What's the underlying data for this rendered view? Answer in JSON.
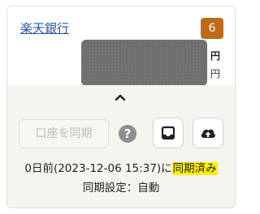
{
  "account": {
    "bank_name": "楽天銀行",
    "count": "6",
    "currency_row1": "円",
    "currency_row2": "円"
  },
  "actions": {
    "sync_label": "口座を同期",
    "help_label": "?"
  },
  "status": {
    "prefix": "0日前(2023-12-06 15:37)に",
    "highlight": "同期済み",
    "highlight_color": "#fff000"
  },
  "setting": "同期設定：自動",
  "colors": {
    "badge": "#c06a19",
    "link": "#2a56a8",
    "footer_bg": "#f6f4ef"
  },
  "icons": [
    "chevron-up-icon",
    "help-icon",
    "inbox-icon",
    "cloud-upload-icon"
  ]
}
